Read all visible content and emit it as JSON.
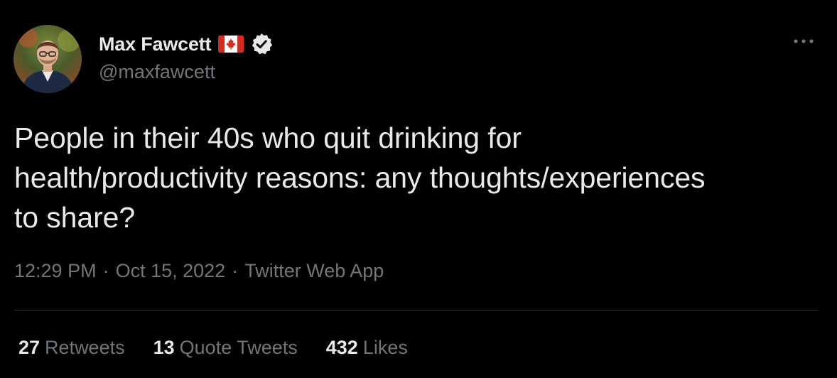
{
  "author": {
    "display_name": "Max Fawcett",
    "handle": "@maxfawcett",
    "avatar_icon": "profile-photo",
    "flag_icon": "canada-flag-emoji",
    "verified_icon": "verified-badge"
  },
  "tweet": {
    "text": "People in their 40s who quit drinking for\nhealth/productivity reasons: any thoughts/experiences\nto share?"
  },
  "meta": {
    "time": "12:29 PM",
    "separator": "·",
    "date": "Oct 15, 2022",
    "source": "Twitter Web App"
  },
  "stats": {
    "retweets": {
      "count": "27",
      "label": "Retweets"
    },
    "quote_tweets": {
      "count": "13",
      "label": "Quote Tweets"
    },
    "likes": {
      "count": "432",
      "label": "Likes"
    }
  },
  "menu": {
    "icon": "more-horizontal-icon"
  },
  "colors": {
    "background": "#000000",
    "primary_text": "#e7e9ea",
    "secondary_text": "#71767b",
    "divider": "#2f3336",
    "flag_red": "#d52b1e"
  }
}
